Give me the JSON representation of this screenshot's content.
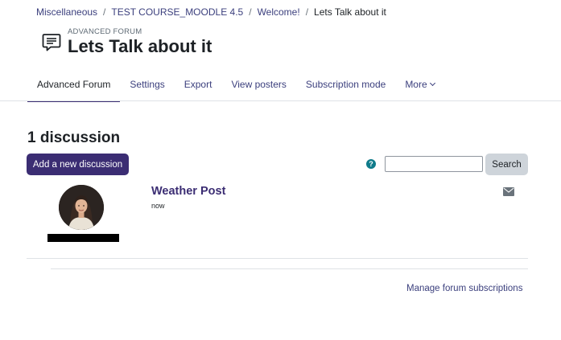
{
  "breadcrumb": {
    "items": [
      "Miscellaneous",
      "TEST COURSE_MOODLE 4.5",
      "Welcome!"
    ],
    "current": "Lets Talk about it",
    "separator": "/"
  },
  "header": {
    "pretitle": "ADVANCED FORUM",
    "title": "Lets Talk about it",
    "icon": "forum-icon"
  },
  "nav": {
    "tabs": [
      {
        "label": "Advanced Forum",
        "active": true
      },
      {
        "label": "Settings"
      },
      {
        "label": "Export"
      },
      {
        "label": "View posters"
      },
      {
        "label": "Subscription mode"
      },
      {
        "label": "More"
      }
    ]
  },
  "main": {
    "discussion_count": "1 discussion",
    "add_button": "Add a new discussion",
    "help_icon": "?",
    "search_value": "",
    "search_button": "Search"
  },
  "post": {
    "title": "Weather Post",
    "time": "now",
    "mail_icon": "mail-icon"
  },
  "footer": {
    "manage_link": "Manage forum subscriptions"
  },
  "colors": {
    "primary": "#3b2d73",
    "link": "#3b3f7d",
    "help": "#0f7b8a"
  }
}
